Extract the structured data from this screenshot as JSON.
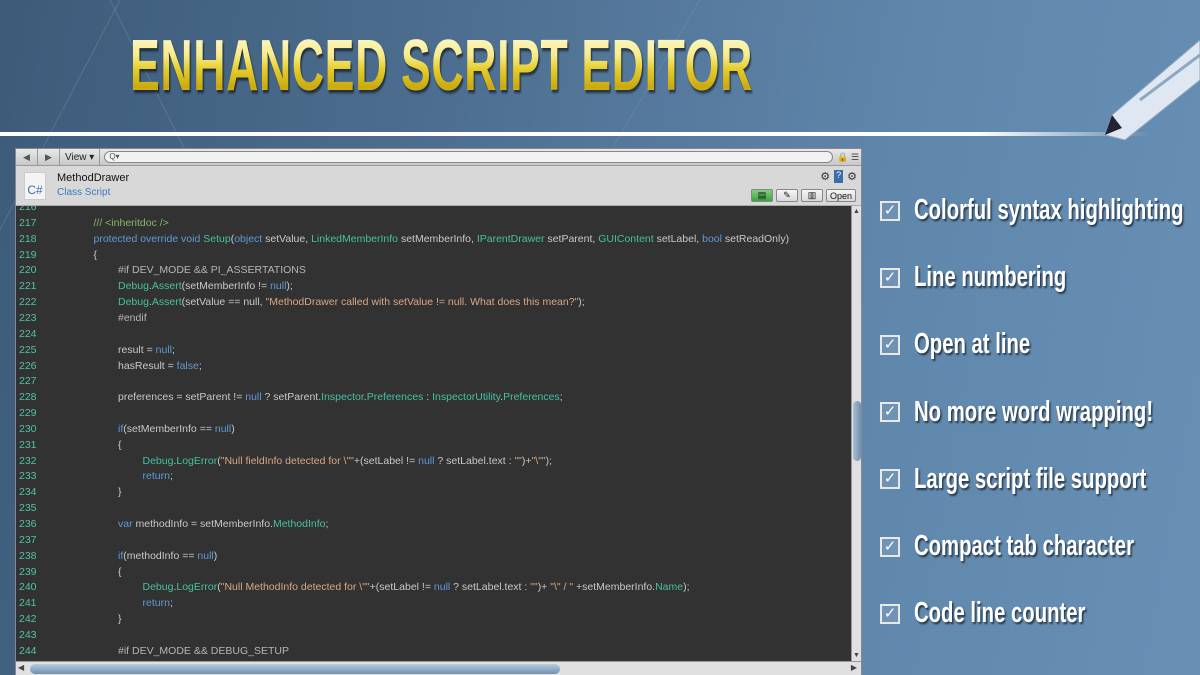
{
  "title": "ENHANCED SCRIPT EDITOR",
  "colors": {
    "title_gold": "#e6cc2a",
    "background": "#4d6e90",
    "code_bg": "#323232",
    "line_number": "#4fc3a8",
    "keyword": "#5f9ad8",
    "type": "#45c1a0",
    "string": "#d8a784",
    "comment": "#86b964"
  },
  "toolbar": {
    "back_icon": "triangle-left-icon",
    "forward_icon": "triangle-right-icon",
    "view_label": "View",
    "view_caret": "▾",
    "search_placeholder": "Q▾",
    "lock_icon": "lock-icon",
    "menu_icon": "window-menu-icon"
  },
  "header": {
    "file_icon_label": "C#",
    "file_name": "MethodDrawer",
    "file_type": "Class Script",
    "icons": [
      "⚙",
      "?",
      "⚙"
    ],
    "buttons": [
      {
        "label": "▤",
        "icon": "code-view-icon",
        "active": true
      },
      {
        "label": "✎",
        "icon": "pencil-icon"
      },
      {
        "label": "▥",
        "icon": "document-icon"
      },
      {
        "label": "Open"
      }
    ]
  },
  "code": {
    "lines": [
      {
        "n": "216",
        "indent": 0,
        "tokens": []
      },
      {
        "n": "217",
        "indent": 1,
        "tokens": [
          [
            "/// <inheritdoc />",
            "c"
          ]
        ]
      },
      {
        "n": "218",
        "indent": 1,
        "tokens": [
          [
            "protected override void ",
            "k"
          ],
          [
            "Setup",
            "t"
          ],
          [
            "(",
            ""
          ],
          [
            "object",
            "k"
          ],
          [
            " setValue, ",
            ""
          ],
          [
            "LinkedMemberInfo",
            "t"
          ],
          [
            " setMemberInfo, ",
            ""
          ],
          [
            "IParentDrawer",
            "t"
          ],
          [
            " setParent, ",
            ""
          ],
          [
            "GUIContent",
            "t"
          ],
          [
            " setLabel, ",
            ""
          ],
          [
            "bool",
            "k"
          ],
          [
            " setReadOnly)",
            ""
          ]
        ]
      },
      {
        "n": "219",
        "indent": 1,
        "tokens": [
          [
            "{",
            ""
          ]
        ]
      },
      {
        "n": "220",
        "indent": 2,
        "tokens": [
          [
            "#if DEV_MODE && PI_ASSERTATIONS",
            "p"
          ]
        ]
      },
      {
        "n": "221",
        "indent": 2,
        "tokens": [
          [
            "Debug",
            "t"
          ],
          [
            ".",
            ""
          ],
          [
            "Assert",
            "t"
          ],
          [
            "(setMemberInfo != ",
            ""
          ],
          [
            "null",
            "k"
          ],
          [
            ");",
            ""
          ]
        ]
      },
      {
        "n": "222",
        "indent": 2,
        "tokens": [
          [
            "Debug",
            "t"
          ],
          [
            ".",
            ""
          ],
          [
            "Assert",
            "t"
          ],
          [
            "(setValue == null, ",
            ""
          ],
          [
            "\"MethodDrawer called with setValue != null. What does this mean?\"",
            "s"
          ],
          [
            ");",
            ""
          ]
        ]
      },
      {
        "n": "223",
        "indent": 2,
        "tokens": [
          [
            "#endif",
            "p"
          ]
        ]
      },
      {
        "n": "224",
        "indent": 0,
        "tokens": []
      },
      {
        "n": "225",
        "indent": 2,
        "tokens": [
          [
            "result = ",
            ""
          ],
          [
            "null",
            "k"
          ],
          [
            ";",
            ""
          ]
        ]
      },
      {
        "n": "226",
        "indent": 2,
        "tokens": [
          [
            "hasResult = ",
            ""
          ],
          [
            "false",
            "k"
          ],
          [
            ";",
            ""
          ]
        ]
      },
      {
        "n": "227",
        "indent": 0,
        "tokens": []
      },
      {
        "n": "228",
        "indent": 2,
        "tokens": [
          [
            "preferences = setParent != ",
            ""
          ],
          [
            "null",
            "k"
          ],
          [
            " ? setParent.",
            ""
          ],
          [
            "Inspector",
            "t"
          ],
          [
            ".",
            ""
          ],
          [
            "Preferences",
            "t"
          ],
          [
            " : ",
            ""
          ],
          [
            "InspectorUtility",
            "t"
          ],
          [
            ".",
            ""
          ],
          [
            "Preferences",
            "t"
          ],
          [
            ";",
            ""
          ]
        ]
      },
      {
        "n": "229",
        "indent": 0,
        "tokens": []
      },
      {
        "n": "230",
        "indent": 2,
        "tokens": [
          [
            "if",
            "k"
          ],
          [
            "(setMemberInfo == ",
            ""
          ],
          [
            "null",
            "k"
          ],
          [
            ")",
            ""
          ]
        ]
      },
      {
        "n": "231",
        "indent": 2,
        "tokens": [
          [
            "{",
            ""
          ]
        ]
      },
      {
        "n": "232",
        "indent": 3,
        "tokens": [
          [
            "Debug",
            "t"
          ],
          [
            ".",
            ""
          ],
          [
            "LogError",
            "t"
          ],
          [
            "(",
            ""
          ],
          [
            "\"Null fieldInfo detected for \\\"\"",
            "s"
          ],
          [
            "+(setLabel != ",
            ""
          ],
          [
            "null",
            "k"
          ],
          [
            " ? setLabel.text : ",
            ""
          ],
          [
            "\"\"",
            "s"
          ],
          [
            ")+",
            ""
          ],
          [
            "\"\\\"\"",
            "s"
          ],
          [
            ");",
            ""
          ]
        ]
      },
      {
        "n": "233",
        "indent": 3,
        "tokens": [
          [
            "return",
            "k"
          ],
          [
            ";",
            ""
          ]
        ]
      },
      {
        "n": "234",
        "indent": 2,
        "tokens": [
          [
            "}",
            ""
          ]
        ]
      },
      {
        "n": "235",
        "indent": 0,
        "tokens": []
      },
      {
        "n": "236",
        "indent": 2,
        "tokens": [
          [
            "var",
            "k"
          ],
          [
            " methodInfo = setMemberInfo.",
            ""
          ],
          [
            "MethodInfo",
            "t"
          ],
          [
            ";",
            ""
          ]
        ]
      },
      {
        "n": "237",
        "indent": 0,
        "tokens": []
      },
      {
        "n": "238",
        "indent": 2,
        "tokens": [
          [
            "if",
            "k"
          ],
          [
            "(methodInfo == ",
            ""
          ],
          [
            "null",
            "k"
          ],
          [
            ")",
            ""
          ]
        ]
      },
      {
        "n": "239",
        "indent": 2,
        "tokens": [
          [
            "{",
            ""
          ]
        ]
      },
      {
        "n": "240",
        "indent": 3,
        "tokens": [
          [
            "Debug",
            "t"
          ],
          [
            ".",
            ""
          ],
          [
            "LogError",
            "t"
          ],
          [
            "(",
            ""
          ],
          [
            "\"Null MethodInfo detected for \\\"\"",
            "s"
          ],
          [
            "+(setLabel != ",
            ""
          ],
          [
            "null",
            "k"
          ],
          [
            " ? setLabel.text : ",
            ""
          ],
          [
            "\"\"",
            "s"
          ],
          [
            ")+ ",
            ""
          ],
          [
            "\"\\\" / \"",
            "s"
          ],
          [
            " +setMemberInfo.",
            ""
          ],
          [
            "Name",
            "t"
          ],
          [
            ");",
            ""
          ]
        ]
      },
      {
        "n": "241",
        "indent": 3,
        "tokens": [
          [
            "return",
            "k"
          ],
          [
            ";",
            ""
          ]
        ]
      },
      {
        "n": "242",
        "indent": 2,
        "tokens": [
          [
            "}",
            ""
          ]
        ]
      },
      {
        "n": "243",
        "indent": 0,
        "tokens": []
      },
      {
        "n": "244",
        "indent": 2,
        "tokens": [
          [
            "#if DEV_MODE && DEBUG_SETUP",
            "p"
          ]
        ]
      }
    ]
  },
  "features": [
    {
      "label": "Colorful syntax highlighting",
      "checked": true
    },
    {
      "label": "Line numbering",
      "checked": true
    },
    {
      "label": "Open at line",
      "checked": true
    },
    {
      "label": "No more word wrapping!",
      "checked": true
    },
    {
      "label": "Large script file support",
      "checked": true
    },
    {
      "label": "Compact tab character",
      "checked": true
    },
    {
      "label": "Code line counter",
      "checked": true
    }
  ],
  "check_glyph": "☑",
  "scroll_arrows": {
    "up": "▲",
    "down": "▼",
    "left": "◀",
    "right": "▶"
  }
}
